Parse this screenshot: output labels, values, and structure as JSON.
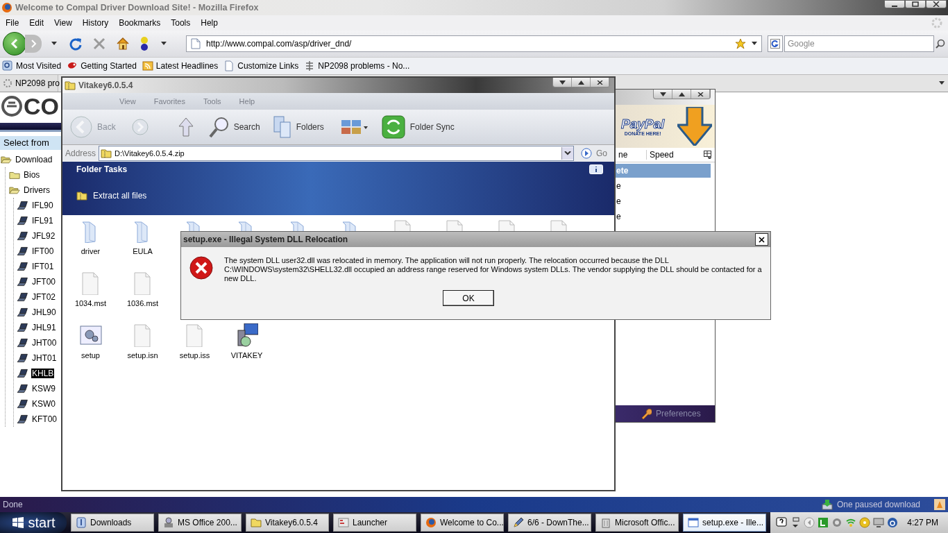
{
  "browser": {
    "title": "Welcome to Compal Driver Download Site! - Mozilla Firefox",
    "menu": [
      "File",
      "Edit",
      "View",
      "History",
      "Bookmarks",
      "Tools",
      "Help"
    ],
    "url": "http://www.compal.com/asp/driver_dnd/",
    "search": {
      "placeholder": "Google"
    },
    "bookmarks": [
      {
        "kind": "magnifier",
        "label": "Most Visited"
      },
      {
        "kind": "bug",
        "label": "Getting Started"
      },
      {
        "kind": "feed",
        "label": "Latest Headlines"
      },
      {
        "kind": "page",
        "label": "Customize Links"
      },
      {
        "kind": "spine",
        "label": "NP2098 problems - No..."
      }
    ],
    "tabs": [
      {
        "label": "NP2098 pro",
        "selected": false
      }
    ],
    "status": "Done",
    "download_status": "One paused download"
  },
  "web_page": {
    "logo": "CO",
    "prompt": "Select from",
    "tree": [
      {
        "kind": "folder",
        "label": "Download",
        "expanded": true,
        "children": [
          {
            "kind": "folder",
            "label": "Bios",
            "expanded": false
          },
          {
            "kind": "folder",
            "label": "Drivers",
            "expanded": true,
            "children": [
              {
                "label": "IFL90",
                "selected": false
              },
              {
                "label": "IFL91",
                "selected": false
              },
              {
                "label": "JFL92",
                "selected": false
              },
              {
                "label": "IFT00",
                "selected": false
              },
              {
                "label": "IFT01",
                "selected": false
              },
              {
                "label": "JFT00",
                "selected": false
              },
              {
                "label": "JFT02",
                "selected": false
              },
              {
                "label": "JHL90",
                "selected": false
              },
              {
                "label": "JHL91",
                "selected": false
              },
              {
                "label": "JHT00",
                "selected": false
              },
              {
                "label": "JHT01",
                "selected": false
              },
              {
                "label": "KHLB",
                "selected": true
              },
              {
                "label": "KSW9",
                "selected": false
              },
              {
                "label": "KSW0",
                "selected": false
              },
              {
                "label": "KFT00",
                "selected": false
              }
            ]
          }
        ]
      }
    ]
  },
  "explorer": {
    "title": "Vitakey6.0.5.4",
    "menu": [
      "View",
      "Favorites",
      "Tools",
      "Help"
    ],
    "toolbar": [
      {
        "kind": "back",
        "label": "Back",
        "disabled": true
      },
      {
        "kind": "forward",
        "disabled": true
      },
      {
        "kind": "up",
        "disabled": false
      },
      {
        "kind": "search",
        "label": "Search",
        "disabled": false
      },
      {
        "kind": "folders",
        "label": "Folders",
        "disabled": false
      },
      {
        "kind": "views",
        "disabled": false
      },
      {
        "kind": "sync",
        "label": "Folder Sync",
        "disabled": false
      }
    ],
    "address_label": "Address",
    "address": "D:\\Vitakey6.0.5.4.zip",
    "go": "Go",
    "tasks_title": "Folder Tasks",
    "tasks": [
      "Extract all files"
    ],
    "file_rows": [
      [
        {
          "kind": "folder",
          "name": "driver"
        },
        {
          "kind": "folder",
          "name": "EULA"
        },
        {
          "kind": "folder"
        },
        {
          "kind": "folder"
        },
        {
          "kind": "folder"
        },
        {
          "kind": "folder"
        },
        {
          "kind": "file"
        },
        {
          "kind": "file"
        },
        {
          "kind": "file"
        },
        {
          "kind": "file"
        }
      ],
      [
        {
          "kind": "file",
          "name": "1034.mst"
        },
        {
          "kind": "file",
          "name": "1036.mst"
        }
      ],
      [
        {
          "kind": "setup",
          "name": "setup"
        },
        {
          "kind": "file",
          "name": "setup.isn"
        },
        {
          "kind": "file",
          "name": "setup.iss"
        },
        {
          "kind": "installer",
          "name": "VITAKEY"
        }
      ]
    ]
  },
  "download_window": {
    "banner": {
      "logo": "PayPal",
      "caption": "DONATE HERE!"
    },
    "columns": [
      "ne",
      "Speed"
    ],
    "rows": [
      {
        "name": "ete",
        "selected": true
      },
      {
        "name": "e",
        "selected": false
      },
      {
        "name": "e",
        "selected": false
      },
      {
        "name": "e",
        "selected": false
      }
    ],
    "footer": "Preferences"
  },
  "dialog": {
    "title": "setup.exe - Illegal System DLL Relocation",
    "message": "The system DLL user32.dll was relocated in memory. The application will not run properly. The relocation occurred because the DLL C:\\WINDOWS\\system32\\SHELL32.dll occupied an address range reserved for Windows system DLLs. The vendor supplying the DLL should be contacted for a new DLL.",
    "button": "OK"
  },
  "taskbar": {
    "start": "start",
    "items": [
      {
        "kind": "downloads",
        "label": "Downloads",
        "selected": false
      },
      {
        "kind": "installer",
        "label": "MS Office 200...",
        "selected": false
      },
      {
        "kind": "zip",
        "label": "Vitakey6.0.5.4",
        "selected": false
      },
      {
        "kind": "launcher",
        "label": "Launcher",
        "selected": false
      },
      {
        "kind": "firefox",
        "label": "Welcome to Co...",
        "selected": false
      },
      {
        "kind": "pencil",
        "label": "6/6 - DownThe...",
        "selected": false
      },
      {
        "kind": "trash",
        "label": "Microsoft Offic...",
        "selected": false
      },
      {
        "kind": "window",
        "label": "setup.exe - Ille...",
        "selected": true
      }
    ],
    "clock": "4:27 PM"
  }
}
